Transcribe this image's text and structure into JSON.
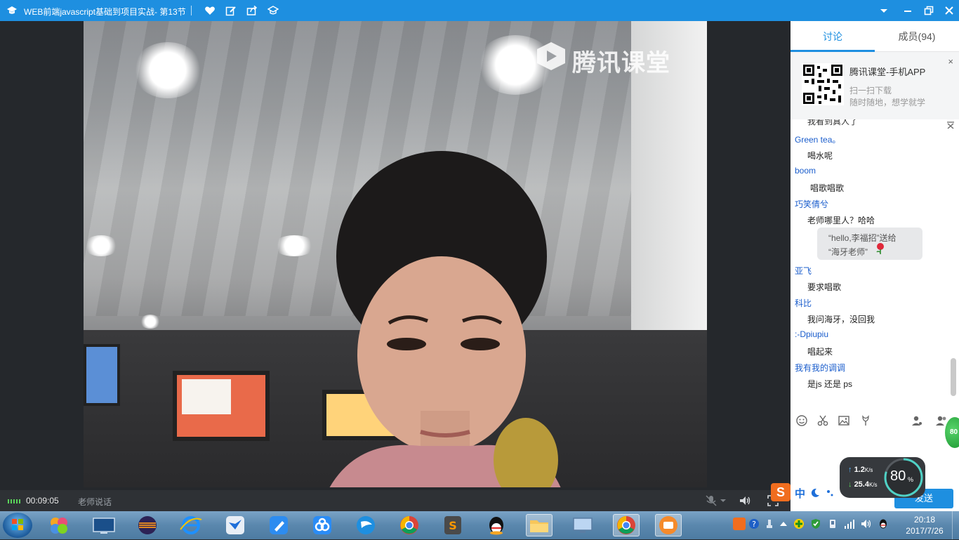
{
  "window": {
    "title": "WEB前端javascript基础到项目实战- 第13节",
    "icons": [
      "graduation-cap-icon",
      "heart-icon",
      "edit-icon",
      "share-icon",
      "mortarboard-icon",
      "dropdown-icon",
      "minimize-icon",
      "restore-icon",
      "close-icon"
    ]
  },
  "video": {
    "watermark": "腾讯课堂"
  },
  "controls": {
    "elapsed": "00:09:05",
    "speaker_label": "老师说话"
  },
  "panel": {
    "tabs": [
      {
        "label": "讨论",
        "active": true
      },
      {
        "label": "成员(94)",
        "active": false
      }
    ],
    "promo": {
      "title": "腾讯课堂-手机APP",
      "line1": "扫一扫下载",
      "line2": "随时随地，想学就学",
      "close": "×"
    },
    "chat_partial": "我看到真人了",
    "messages": [
      {
        "user": "Green tea。",
        "text": "喝水呢"
      },
      {
        "user": "boom",
        "text": "唱歌唱歌"
      },
      {
        "user": "巧笑倩兮",
        "text": "老师哪里人？哈哈"
      },
      {
        "user": "亚飞",
        "text": "要求唱歌"
      },
      {
        "user": "科比",
        "text": "我问海牙，没回我"
      },
      {
        "user": ":-Dpiupiu",
        "text": "唱起来"
      },
      {
        "user": "我有我的调调",
        "text": "是js  还是 ps"
      }
    ],
    "gift": {
      "line1": "“hello,李福招”送给",
      "line2": "“海牙老师”"
    },
    "send_label": "发送"
  },
  "ime": {
    "brand": "S",
    "lang": "中"
  },
  "network": {
    "upload": "1.2",
    "download": "25.4",
    "unit": "K/s",
    "percent": "80",
    "percent_sign": "%"
  },
  "badge": {
    "value": "80"
  },
  "clock": {
    "time": "20:18",
    "date": "2017/7/26"
  },
  "colors": {
    "accent": "#1e8fe0",
    "username": "#1a5dcc",
    "ime_orange": "#f06d1e"
  }
}
